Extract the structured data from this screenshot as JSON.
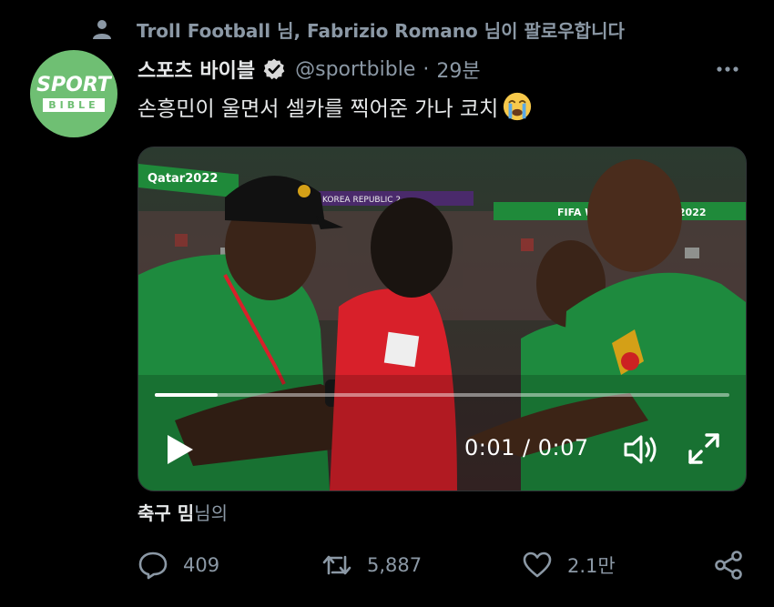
{
  "social_context": {
    "text": "Troll Football 님, Fabrizio Romano 님이 팔로우합니다",
    "icon": "person-icon"
  },
  "author": {
    "avatar_line1": "SPORT",
    "avatar_line2": "BIBLE",
    "display_name": "스포츠 바이블",
    "handle": "@sportbible",
    "separator": "·",
    "time": "29분",
    "verified_icon": "verified-badge-icon",
    "more_icon": "more-options-icon"
  },
  "tweet": {
    "text": "손흥민이 울면서 셀카를 찍어준 가나 코치",
    "emoji": "loudly-crying-face-emoji"
  },
  "video": {
    "current_time": "0:01",
    "time_separator": " / ",
    "duration": "0:07",
    "progress_fraction": 0.11,
    "scene_text": {
      "banner_left": "Qatar2022",
      "banner_right": "FIFA World Cup Qatar2022",
      "scoreboard": "KOREA REPUBLIC  2"
    },
    "colors": {
      "ghana_green": "#1e8a3e",
      "korea_red": "#d8202a"
    }
  },
  "liked_by": {
    "name": "축구 밈",
    "suffix": "님의"
  },
  "actions": {
    "reply_count": "409",
    "retweet_count": "5,887",
    "like_count": "2.1만"
  }
}
